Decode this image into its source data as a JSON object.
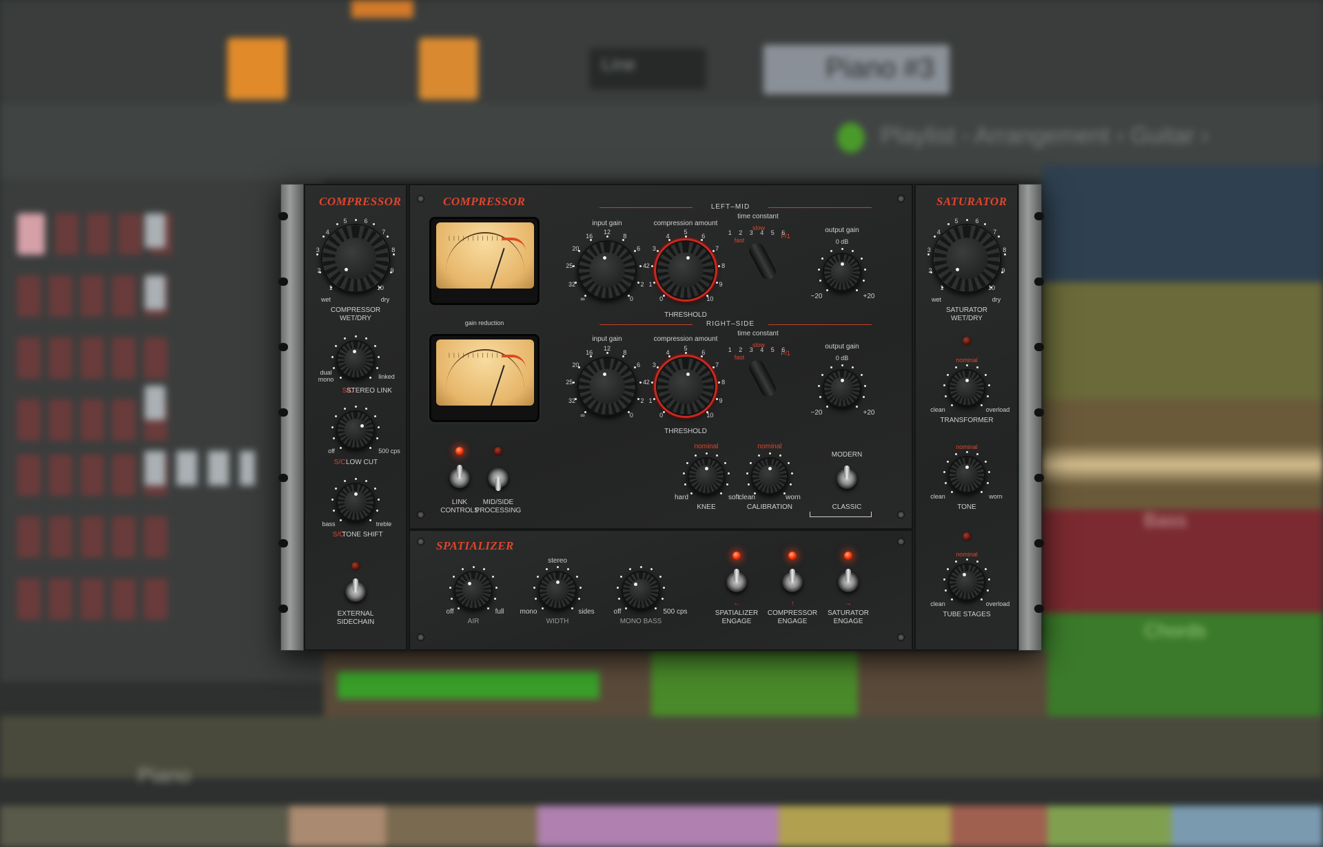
{
  "background_daw": {
    "playlist_breadcrumb": "Playlist - Arrangement › Guitar ›",
    "pattern_selector": "Piano #3",
    "snap_selector": "Line",
    "piano_track": "Piano",
    "bass_track": "Bass",
    "chords_track": "Chords",
    "accent_orange": "#e08a2a",
    "accent_green": "#4a9a2a"
  },
  "left_panel": {
    "title": "COMPRESSOR",
    "wetdry": {
      "label": "COMPRESSOR\nWET/DRY",
      "min": "wet",
      "max": "dry",
      "scale": [
        "1",
        "2",
        "3",
        "4",
        "5",
        "6",
        "7",
        "8",
        "9",
        "10"
      ]
    },
    "stereo_link": {
      "prefix": "S/C",
      "label": "STEREO LINK",
      "min": "dual\nmono",
      "max": "linked"
    },
    "low_cut": {
      "prefix": "S/C",
      "label": "LOW CUT",
      "min": "off",
      "max": "500 cps"
    },
    "tone_shift": {
      "prefix": "S/C",
      "label": "TONE SHIFT",
      "min": "bass",
      "max": "treble"
    },
    "external_sidechain": {
      "label": "EXTERNAL\nSIDECHAIN",
      "led_on": false
    }
  },
  "compressor": {
    "title": "COMPRESSOR",
    "left_mid": {
      "section": "LEFT–MID",
      "input_gain": {
        "label": "input gain",
        "scale": [
          "∞",
          "32",
          "25",
          "20",
          "16",
          "12",
          "8",
          "6",
          "4",
          "2",
          "0"
        ]
      },
      "compression": {
        "label": "compression amount",
        "sub": "THRESHOLD",
        "scale": [
          "0",
          "1",
          "2",
          "3",
          "4",
          "5",
          "6",
          "7",
          "8",
          "9",
          "10"
        ]
      },
      "time_constant": {
        "label": "time constant",
        "fast": "fast",
        "slow": "slow",
        "scale": [
          "1",
          "2",
          "3",
          "4",
          "5",
          "6"
        ],
        "p": "P/1"
      },
      "output_gain": {
        "label": "output gain",
        "center": "0 dB",
        "min": "−20",
        "max": "+20"
      }
    },
    "meter_caption": "gain reduction",
    "right_side": {
      "section": "RIGHT–SIDE",
      "input_gain": {
        "label": "input gain"
      },
      "compression": {
        "label": "compression amount",
        "sub": "THRESHOLD"
      },
      "time_constant": {
        "label": "time constant",
        "fast": "fast",
        "slow": "slow",
        "p": "P/1"
      },
      "output_gain": {
        "label": "output gain",
        "center": "0 dB",
        "min": "−20",
        "max": "+20"
      }
    },
    "link_controls": {
      "label": "LINK\nCONTROLS",
      "led_on": true
    },
    "mid_side": {
      "label": "MID/SIDE\nPROCESSING",
      "led_on": false
    },
    "knee": {
      "label": "KNEE",
      "nominal": "nominal",
      "min": "hard",
      "max": "soft"
    },
    "calibration": {
      "label": "CALIBRATION",
      "nominal": "nominal",
      "min": "clean",
      "max": "worn"
    },
    "mode": {
      "top": "MODERN",
      "bottom": "CLASSIC"
    }
  },
  "spatializer": {
    "title": "SPATIALIZER",
    "air": {
      "label": "AIR",
      "min": "off",
      "max": "full"
    },
    "width": {
      "label": "WIDTH",
      "top": "stereo",
      "min": "mono",
      "max": "sides"
    },
    "mono_bass": {
      "label": "MONO BASS",
      "min": "off",
      "max": "500 cps"
    },
    "engages": [
      {
        "label": "SPATIALIZER\nENGAGE",
        "arrow": "←",
        "led_on": true
      },
      {
        "label": "COMPRESSOR\nENGAGE",
        "arrow": "↑",
        "led_on": true
      },
      {
        "label": "SATURATOR\nENGAGE",
        "arrow": "→",
        "led_on": true
      }
    ]
  },
  "saturator": {
    "title": "SATURATOR",
    "wetdry": {
      "label": "SATURATOR\nWET/DRY",
      "min": "wet",
      "max": "dry",
      "scale": [
        "1",
        "2",
        "3",
        "4",
        "5",
        "6",
        "7",
        "8",
        "9",
        "10"
      ]
    },
    "transformer": {
      "label": "TRANSFORMER",
      "nominal": "nominal",
      "min": "clean",
      "max": "overload"
    },
    "tone": {
      "label": "TONE",
      "nominal": "nominal",
      "min": "clean",
      "max": "worn"
    },
    "tube_stages": {
      "label": "TUBE STAGES",
      "nominal": "nominal",
      "min": "clean",
      "max": "overload"
    }
  },
  "colors": {
    "accent_red": "#e0452c",
    "led_red": "#ff3a10",
    "knob_ring_red": "#c9291f"
  }
}
